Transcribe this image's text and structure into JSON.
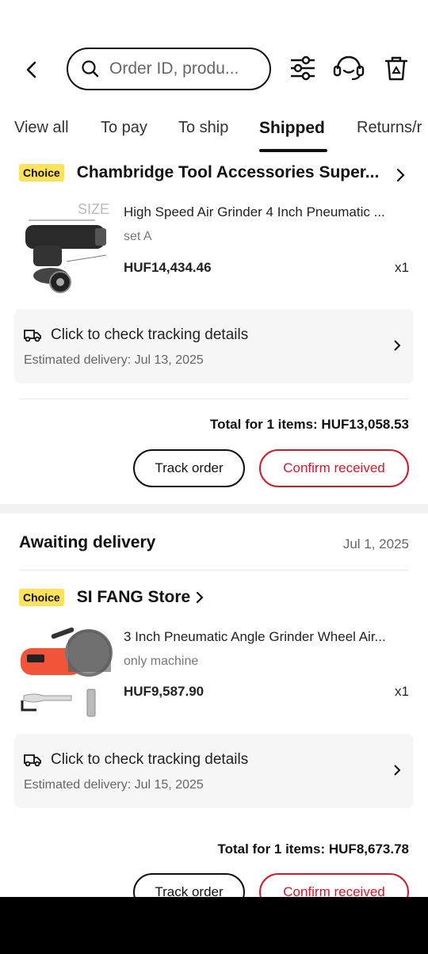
{
  "search": {
    "placeholder": "Order ID, produ..."
  },
  "tabs": [
    {
      "label": "View all"
    },
    {
      "label": "To pay"
    },
    {
      "label": "To ship"
    },
    {
      "label": "Shipped"
    },
    {
      "label": "Returns/r"
    }
  ],
  "active_tab": "Shipped",
  "orders": [
    {
      "badge": "Choice",
      "store": "Chambridge Tool Accessories Super...",
      "product": "High Speed Air Grinder 4 Inch Pneumatic ...",
      "variant": "set A",
      "price": "HUF14,434.46",
      "qty": "x1",
      "tracking_title": "Click to check tracking details",
      "estimated": "Estimated delivery: Jul 13, 2025",
      "total": "Total for 1 items: HUF13,058.53",
      "track_btn": "Track order",
      "confirm_btn": "Confirm received",
      "thumb_text": "SIZE"
    },
    {
      "status": "Awaiting delivery",
      "date": "Jul 1, 2025",
      "badge": "Choice",
      "store": "SI FANG Store",
      "product": "3 Inch Pneumatic Angle Grinder Wheel Air...",
      "variant": "only machine",
      "price": "HUF9,587.90",
      "qty": "x1",
      "tracking_title": "Click to check tracking details",
      "estimated": "Estimated delivery: Jul 15, 2025",
      "total": "Total for 1 items: HUF8,673.78",
      "track_btn": "Track order",
      "confirm_btn": "Confirm received"
    }
  ],
  "colors": {
    "accent_red": "#cf1b2b",
    "choice_yellow": "#ffe25c",
    "track_bg": "#f6f6f6"
  },
  "icons": [
    "back-arrow-icon",
    "search-icon",
    "filter-icon",
    "support-headset-icon",
    "delete-bin-icon",
    "chevron-right-icon",
    "truck-icon"
  ]
}
